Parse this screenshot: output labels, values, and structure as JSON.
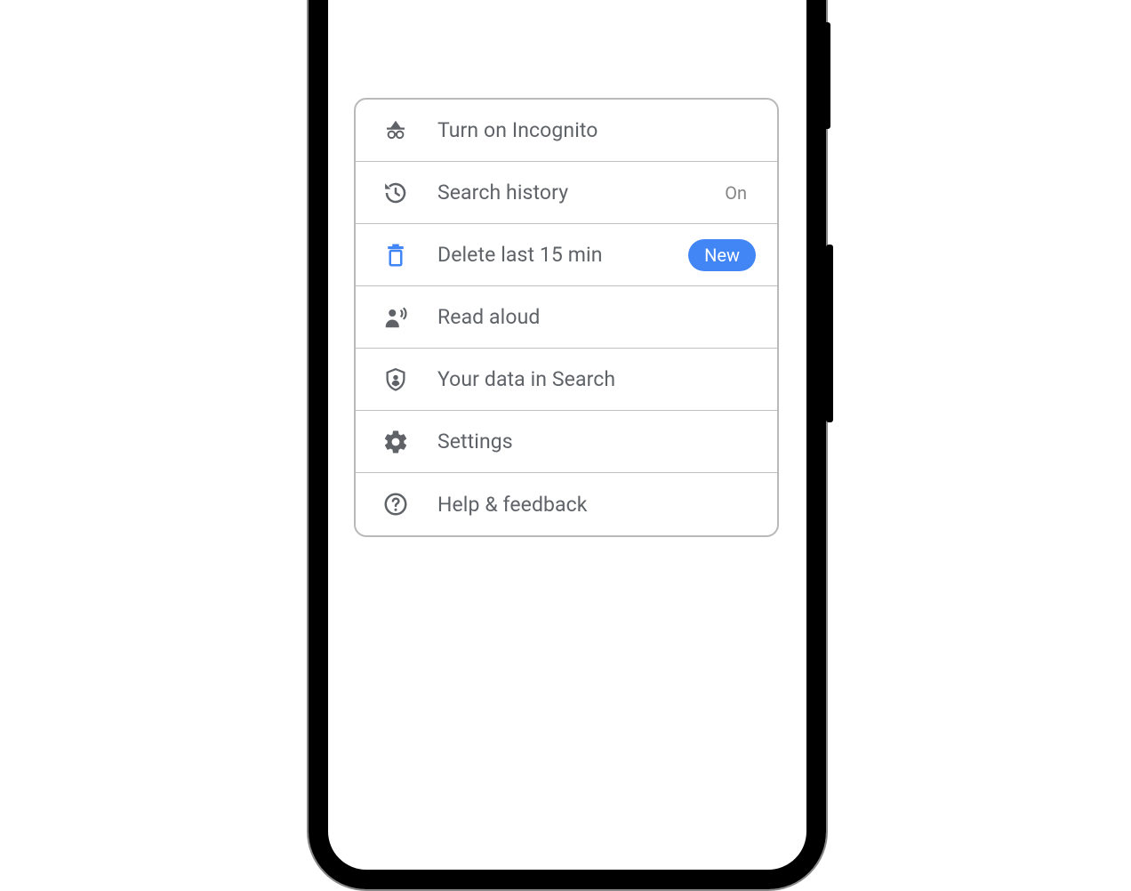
{
  "menu": {
    "items": [
      {
        "label": "Turn on Incognito"
      },
      {
        "label": "Search history",
        "status": "On"
      },
      {
        "label": "Delete last 15 min",
        "badge": "New"
      },
      {
        "label": "Read aloud"
      },
      {
        "label": "Your data in Search"
      },
      {
        "label": "Settings"
      },
      {
        "label": "Help & feedback"
      }
    ]
  },
  "colors": {
    "icon_default": "#5f6368",
    "icon_blue": "#4285f4",
    "badge_bg": "#4285f4"
  }
}
